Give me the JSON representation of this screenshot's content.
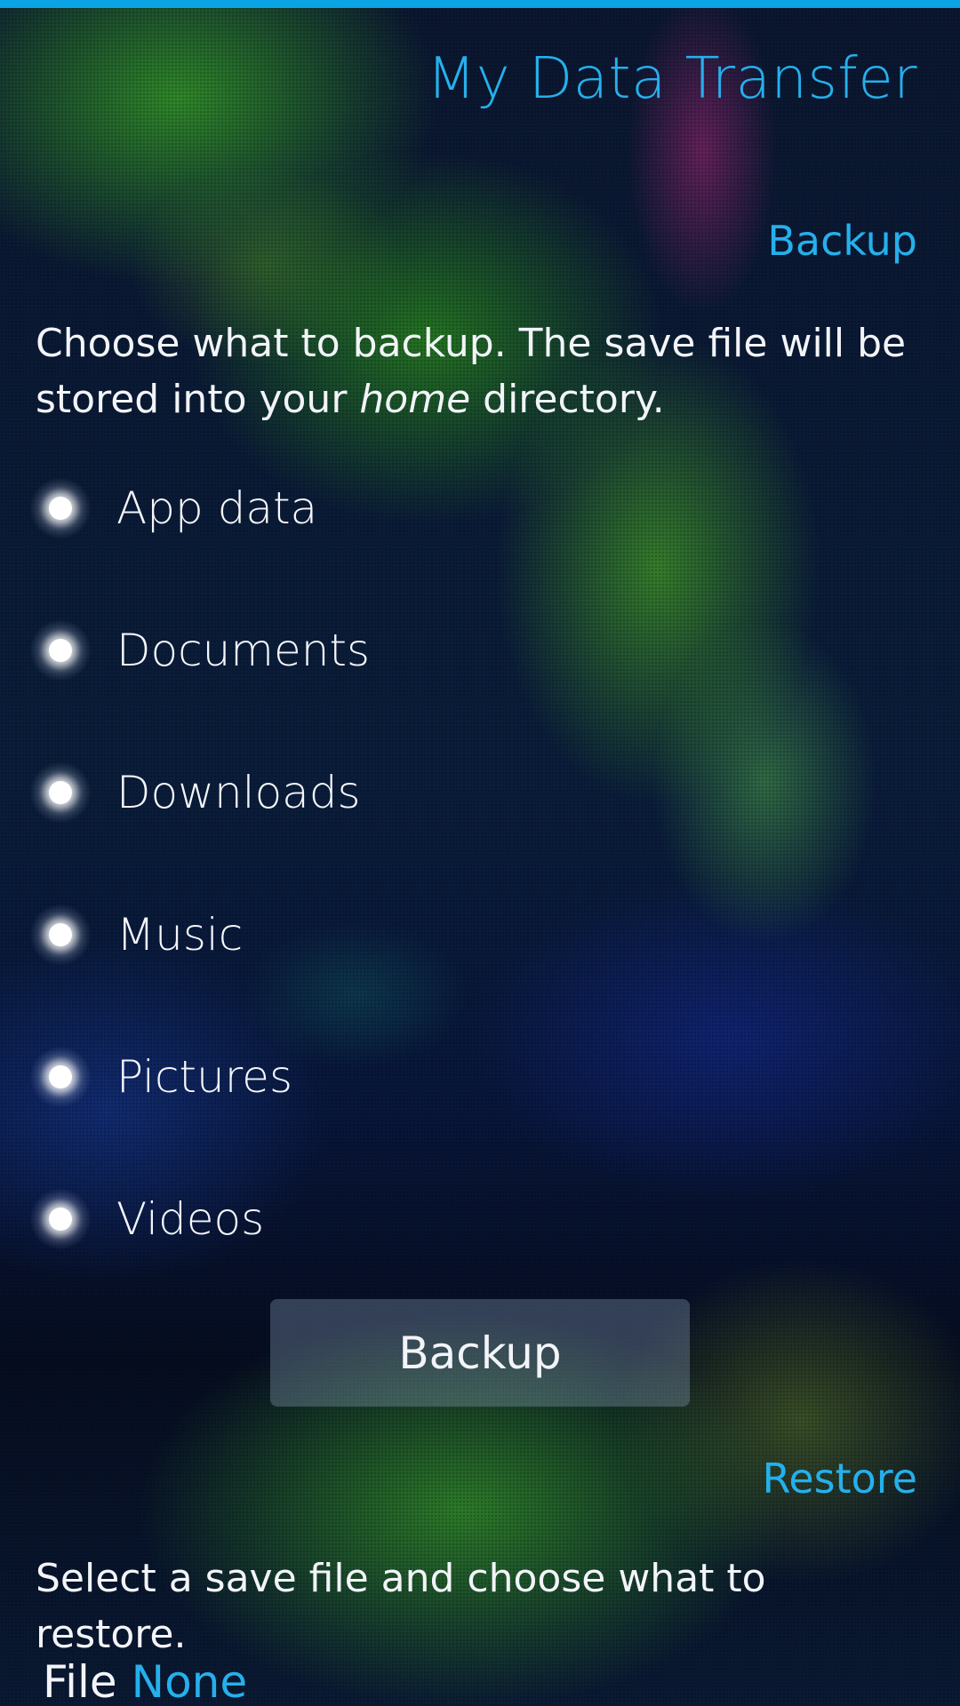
{
  "app": {
    "title": "My Data Transfer"
  },
  "backup": {
    "header": "Backup",
    "description_before": "Choose what to backup. The save file will be stored into your ",
    "description_emphasis": "home",
    "description_after": " directory.",
    "options": [
      {
        "label": "App data",
        "checked": true
      },
      {
        "label": "Documents",
        "checked": true
      },
      {
        "label": "Downloads",
        "checked": true
      },
      {
        "label": "Music",
        "checked": true
      },
      {
        "label": "Pictures",
        "checked": true
      },
      {
        "label": "Videos",
        "checked": true
      }
    ],
    "button_label": "Backup"
  },
  "restore": {
    "header": "Restore",
    "description": "Select a save file and choose what to restore.",
    "file_label": "File",
    "file_value": "None"
  },
  "colors": {
    "accent": "#25b0ec",
    "top_bar": "#0aa3e3",
    "text": "#f2f4f8"
  }
}
